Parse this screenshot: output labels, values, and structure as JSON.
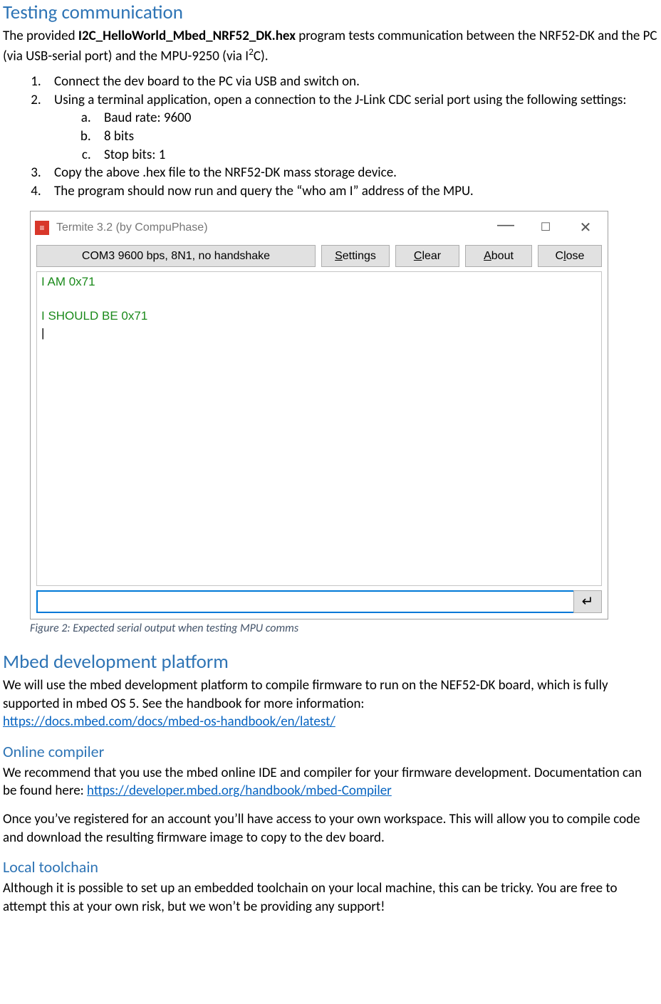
{
  "section1": {
    "heading": "Testing communication",
    "intro_a": "The provided ",
    "intro_bold": "I2C_HelloWorld_Mbed_NRF52_DK.hex",
    "intro_b": " program tests communication between the NRF52-DK and the PC (via USB-serial port) and the MPU-9250 (via I",
    "intro_sup": "2",
    "intro_c": "C)."
  },
  "steps": {
    "s1": "Connect the dev board to the PC via USB and switch on.",
    "s2": "Using a terminal application, open a connection to the J-Link CDC serial port using the following settings:",
    "s2a": "Baud rate: 9600",
    "s2b": "8 bits",
    "s2c": "Stop bits: 1",
    "s3": "Copy the above .hex file to the NRF52-DK mass storage device.",
    "s4": "The program should now run and query the “who am I” address of the MPU."
  },
  "termite": {
    "title": "Termite 3.2 (by CompuPhase)",
    "port": "COM3 9600 bps, 8N1, no handshake",
    "btn_settings": "ettings",
    "btn_clear": "lear",
    "btn_about": "bout",
    "btn_close": "lose",
    "out1": "I AM 0x71",
    "out2": "I SHOULD BE 0x71",
    "send_glyph": "↵"
  },
  "figcap": "Figure 2: Expected serial output when testing MPU comms",
  "section2": {
    "heading": "Mbed development platform",
    "p1": "We will use the mbed development platform to compile firmware to run on the NEF52-DK board, which is fully supported in mbed OS 5. See the handbook for more information:",
    "link1": "https://docs.mbed.com/docs/mbed-os-handbook/en/latest/"
  },
  "section3": {
    "heading": "Online compiler",
    "p1": "We recommend that you use the mbed online IDE and compiler for your firmware development. Documentation can be found here: ",
    "link1": "https://developer.mbed.org/handbook/mbed-Compiler",
    "p2": "Once you’ve registered for an account you’ll have access to your own workspace. This will allow you to compile code and download the resulting firmware image to copy to the dev board."
  },
  "section4": {
    "heading": "Local toolchain",
    "p1": "Although it is possible to set up an embedded toolchain on your local machine, this can be tricky. You are free to attempt this at your own risk, but we won’t be providing any support!"
  }
}
